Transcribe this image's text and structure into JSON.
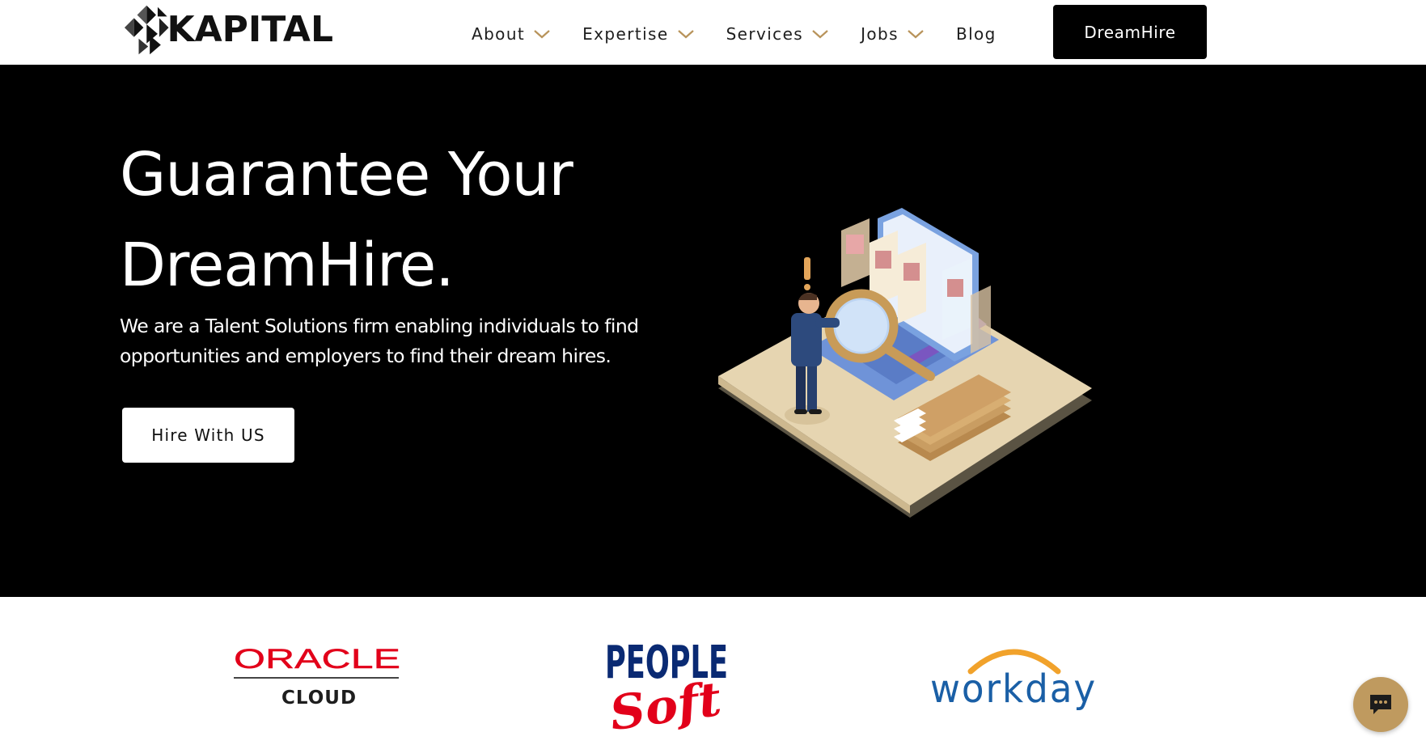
{
  "brand": {
    "name": "KAPITAL"
  },
  "nav": {
    "items": [
      {
        "label": "About",
        "has_dropdown": true
      },
      {
        "label": "Expertise",
        "has_dropdown": true
      },
      {
        "label": "Services",
        "has_dropdown": true
      },
      {
        "label": "Jobs",
        "has_dropdown": true
      },
      {
        "label": "Blog",
        "has_dropdown": false
      }
    ],
    "cta_label": "DreamHire"
  },
  "hero": {
    "title_line1": "Guarantee Your",
    "title_line2": "DreamHire.",
    "subtitle_line1": "We are a Talent Solutions firm enabling individuals to find",
    "subtitle_line2": "opportunities and employers to find their dream hires.",
    "button_label": "Hire With US"
  },
  "partners": {
    "oracle": {
      "name": "ORACLE",
      "sub": "CLOUD",
      "color": "#e2001a"
    },
    "peoplesoft": {
      "top": "PEOPLE",
      "bottom": "Soft",
      "top_color": "#0a2a73",
      "bottom_color": "#e2001a"
    },
    "workday": {
      "name": "workday",
      "color": "#1a5fa6",
      "arc_color": "#f1a22b"
    }
  },
  "colors": {
    "accent": "#bf9a5f",
    "hero_bg": "#000000",
    "chevron": "#b8935a"
  },
  "chat": {
    "icon": "chat-bubble-icon"
  }
}
